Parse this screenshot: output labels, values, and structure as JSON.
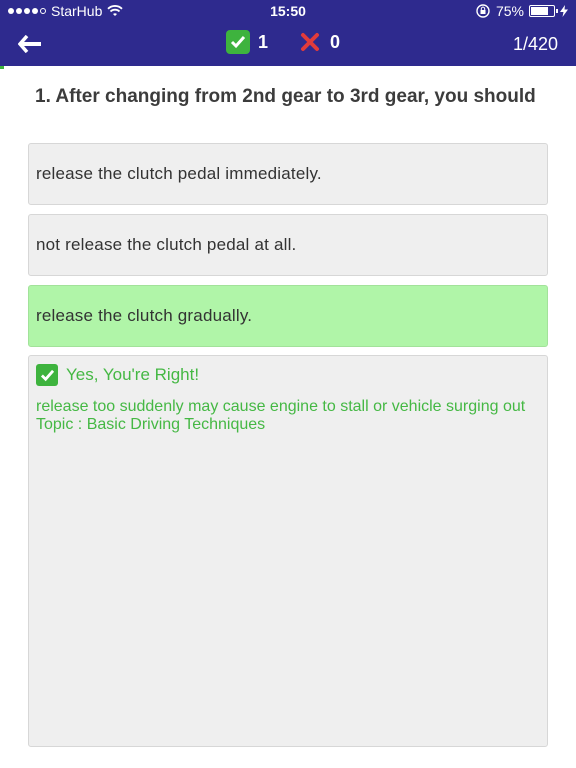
{
  "status_bar": {
    "carrier": "StarHub",
    "time": "15:50",
    "battery_text": "75%",
    "battery_level": 0.75
  },
  "nav": {
    "correct_count": "1",
    "wrong_count": "0",
    "progress": "1/420"
  },
  "question": {
    "text": "1. After changing from 2nd gear to 3rd gear, you should"
  },
  "options": [
    {
      "label": "release the clutch pedal immediately."
    },
    {
      "label": "not release the clutch pedal at all."
    },
    {
      "label": "release the clutch gradually."
    }
  ],
  "feedback": {
    "result": "Yes, You're Right!",
    "explanation": "release too suddenly may cause engine to stall or vehicle surging out",
    "topic": "Topic : Basic Driving Techniques"
  },
  "colors": {
    "nav_bg": "#2e2a8e",
    "correct_bg": "#b0f5a8",
    "feedback_text": "#45b844"
  }
}
